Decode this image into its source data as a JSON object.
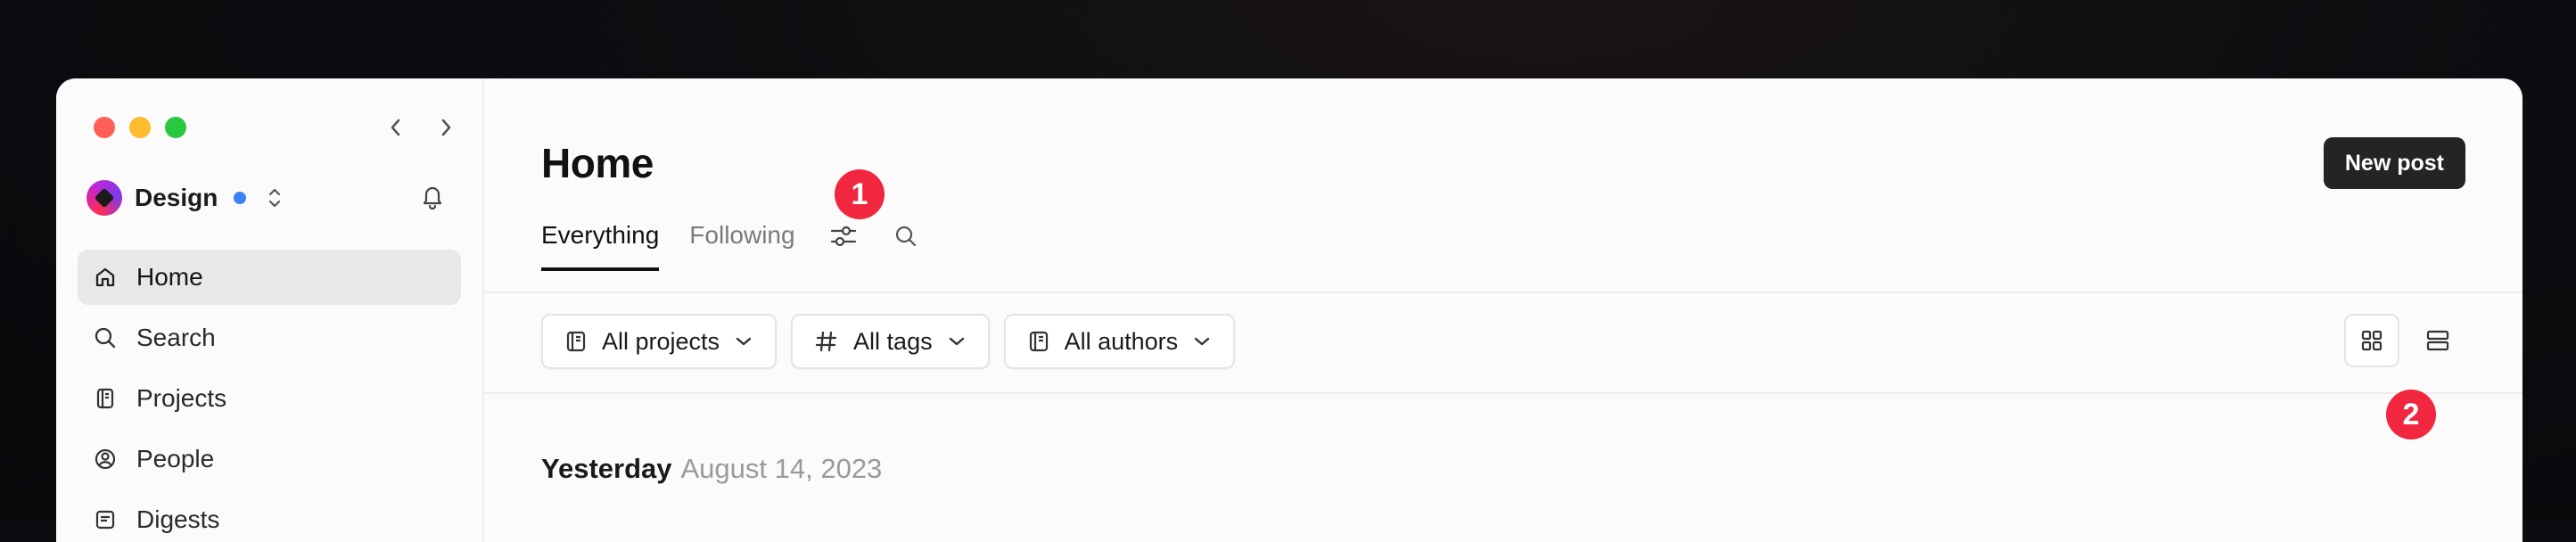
{
  "sidebar": {
    "workspace": {
      "name": "Design",
      "status_color": "#3b82f6"
    },
    "items": [
      {
        "label": "Home",
        "icon": "home-icon",
        "active": true
      },
      {
        "label": "Search",
        "icon": "search-icon"
      },
      {
        "label": "Projects",
        "icon": "projects-icon"
      },
      {
        "label": "People",
        "icon": "person-icon"
      },
      {
        "label": "Digests",
        "icon": "digest-icon"
      }
    ]
  },
  "main": {
    "title": "Home",
    "new_post_label": "New post",
    "tabs": [
      {
        "label": "Everything",
        "active": true
      },
      {
        "label": "Following"
      }
    ],
    "filters": [
      {
        "label": "All projects",
        "icon": "projects-icon"
      },
      {
        "label": "All tags",
        "icon": "hash-icon"
      },
      {
        "label": "All authors",
        "icon": "projects-icon"
      }
    ],
    "group": {
      "day": "Yesterday",
      "date": "August 14, 2023"
    }
  },
  "callouts": {
    "one": "1",
    "two": "2"
  },
  "colors": {
    "callout": "#f0273f",
    "new_post_bg": "#242424",
    "accent": "#3b82f6"
  }
}
